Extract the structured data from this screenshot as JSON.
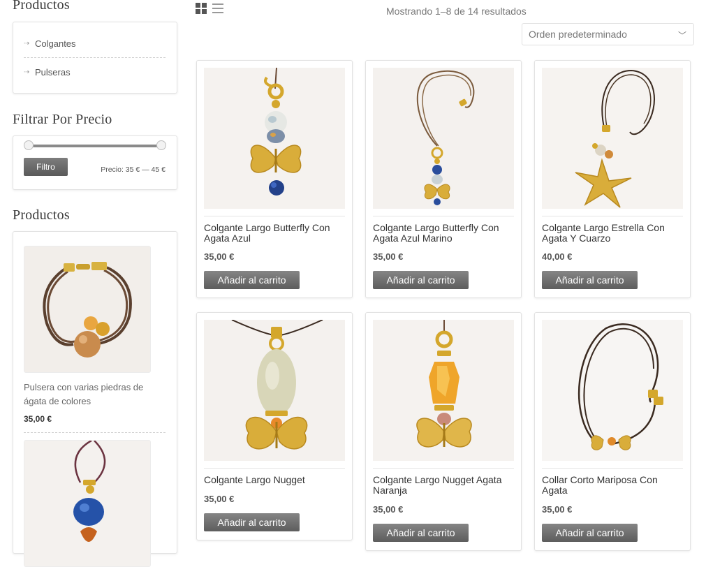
{
  "sidebar": {
    "categories_title": "Productos",
    "categories": [
      {
        "label": "Colgantes"
      },
      {
        "label": "Pulseras"
      }
    ],
    "price_filter": {
      "title": "Filtrar Por Precio",
      "button_label": "Filtro",
      "price_text": "Precio: 35 € — 45 €",
      "min_value": 35,
      "max_value": 45
    },
    "products_title": "Productos",
    "products": [
      {
        "name": "Pulsera con varias piedras de ágata de colores",
        "price": "35,00 €"
      }
    ]
  },
  "toolbar": {
    "grid_icon": "grid-view-icon",
    "list_icon": "list-view-icon",
    "result_count": "Mostrando 1–8 de 14 resultados",
    "orderby_selected": "Orden predeterminado"
  },
  "products": [
    {
      "name": "Colgante Largo Butterfly Con Agata Azul",
      "price": "35,00 €",
      "button": "Añadir al carrito"
    },
    {
      "name": "Colgante Largo Butterfly Con Agata Azul Marino",
      "price": "35,00 €",
      "button": "Añadir al carrito"
    },
    {
      "name": "Colgante Largo Estrella Con Agata Y Cuarzo",
      "price": "40,00 €",
      "button": "Añadir al carrito"
    },
    {
      "name": "Colgante Largo Nugget",
      "price": "35,00 €",
      "button": "Añadir al carrito"
    },
    {
      "name": "Colgante Largo Nugget Agata Naranja",
      "price": "35,00 €",
      "button": "Añadir al carrito"
    },
    {
      "name": "Collar Corto Mariposa Con Agata",
      "price": "35,00 €",
      "button": "Añadir al carrito"
    }
  ],
  "colors": {
    "button_bg": "#6b6b6b",
    "gold": "#d4a72c",
    "cord": "#5a3f2e"
  }
}
